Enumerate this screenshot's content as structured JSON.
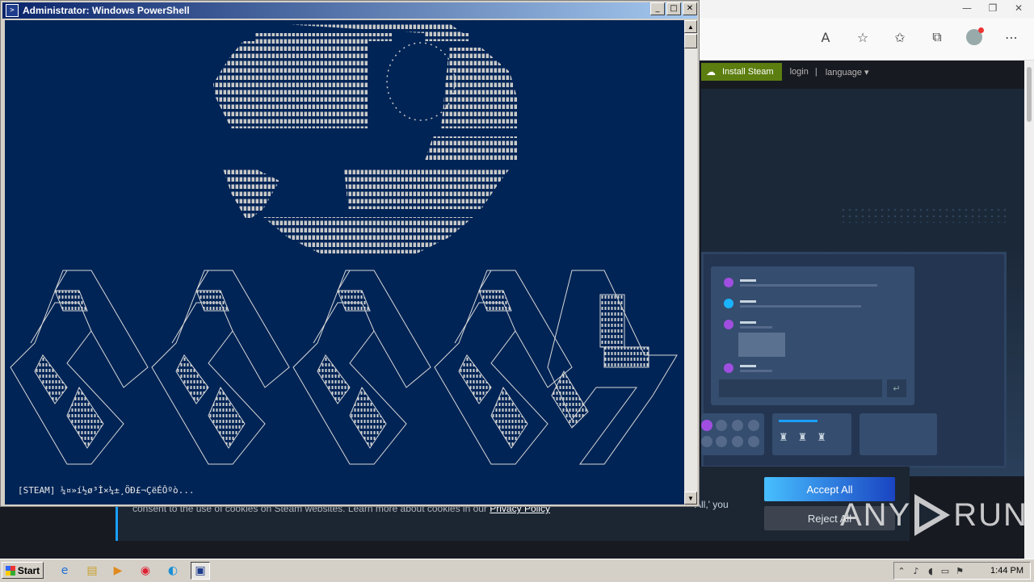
{
  "browser": {
    "window_controls": [
      "—",
      "❐",
      "✕"
    ],
    "toolbar_icons": [
      "read-aloud-icon",
      "add-favorite-icon",
      "favorites-icon",
      "collections-icon",
      "profile-avatar",
      "more-icon"
    ]
  },
  "steam": {
    "install_label": "Install Steam",
    "login_label": "login",
    "separator": "|",
    "language_label": "language",
    "cookie_text": "consent to the use of cookies on Steam websites. Learn more about cookies in our",
    "privacy_label": "Privacy Policy",
    "cookie_tail": "All,' you",
    "accept_label": "Accept All",
    "reject_label": "Reject All"
  },
  "watermark": {
    "left": "ANY",
    "right": "RUN"
  },
  "powershell": {
    "title": "Administrator: Windows PowerShell",
    "controls": [
      "_",
      "□",
      "✕"
    ],
    "status_line": "[STEAM] ¼¤»í½ø³Ì×¼±¸ÖÐ£¬ÇëÉÔºò..."
  },
  "taskbar": {
    "start_label": "Start",
    "apps": [
      "ie-icon",
      "explorer-icon",
      "media-player-icon",
      "chrome-icon",
      "edge-icon",
      "powershell-icon"
    ],
    "clock": "1:44 PM"
  }
}
